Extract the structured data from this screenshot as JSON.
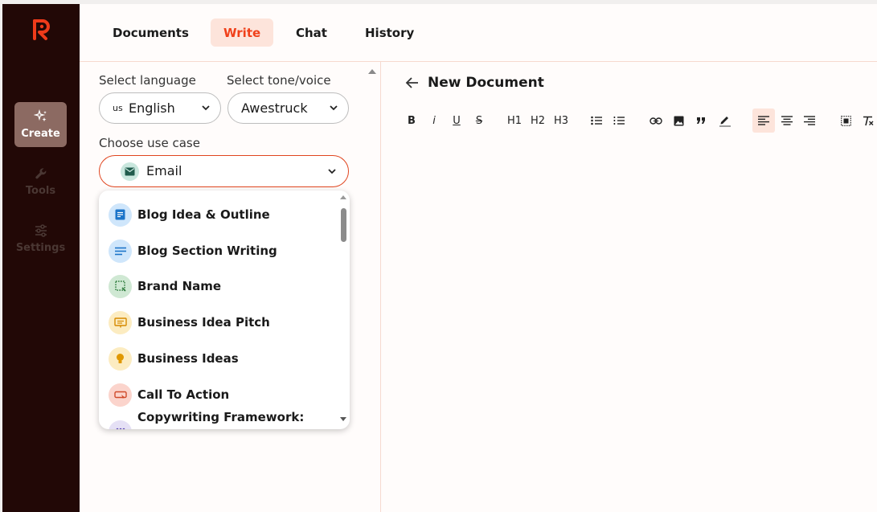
{
  "app": {
    "logo_text": "R",
    "brand_color": "#ef3b1a"
  },
  "sidebar": {
    "items": [
      {
        "label": "Create",
        "icon": "sparkles-icon",
        "active": true
      },
      {
        "label": "Tools",
        "icon": "wrench-icon",
        "active": false
      },
      {
        "label": "Settings",
        "icon": "sliders-icon",
        "active": false
      }
    ]
  },
  "tabs": [
    {
      "label": "Documents",
      "active": false
    },
    {
      "label": "Write",
      "active": true
    },
    {
      "label": "Chat",
      "active": false
    },
    {
      "label": "History",
      "active": false
    }
  ],
  "form": {
    "language_label": "Select language",
    "language_flag": "us",
    "language_value": "English",
    "tone_label": "Select tone/voice",
    "tone_value": "Awestruck",
    "use_case_label": "Choose use case",
    "use_case_value": "Email",
    "use_case_icon": "email-icon"
  },
  "use_case_options": [
    {
      "label": "Blog Idea & Outline",
      "icon": "document-icon",
      "bg": "#cfe6fb",
      "fg": "#1b74c9"
    },
    {
      "label": "Blog Section Writing",
      "icon": "lines-icon",
      "bg": "#cfe6fb",
      "fg": "#1b74c9"
    },
    {
      "label": "Brand Name",
      "icon": "brand-frame-icon",
      "bg": "#cfe8d3",
      "fg": "#2c7a3b"
    },
    {
      "label": "Business Idea Pitch",
      "icon": "presentation-icon",
      "bg": "#fcecc1",
      "fg": "#d68a00"
    },
    {
      "label": "Business Ideas",
      "icon": "lightbulb-icon",
      "bg": "#fcecc1",
      "fg": "#e09800"
    },
    {
      "label": "Call To Action",
      "icon": "button-icon",
      "bg": "#fbd4cc",
      "fg": "#d04a2b"
    },
    {
      "label": "Copywriting Framework:",
      "icon": "grid-icon",
      "bg": "#e5e0f5",
      "fg": "#5b46b5"
    }
  ],
  "editor": {
    "title": "New Document",
    "toolbar": [
      "B",
      "i",
      "U",
      "S",
      "H1",
      "H2",
      "H3"
    ]
  }
}
